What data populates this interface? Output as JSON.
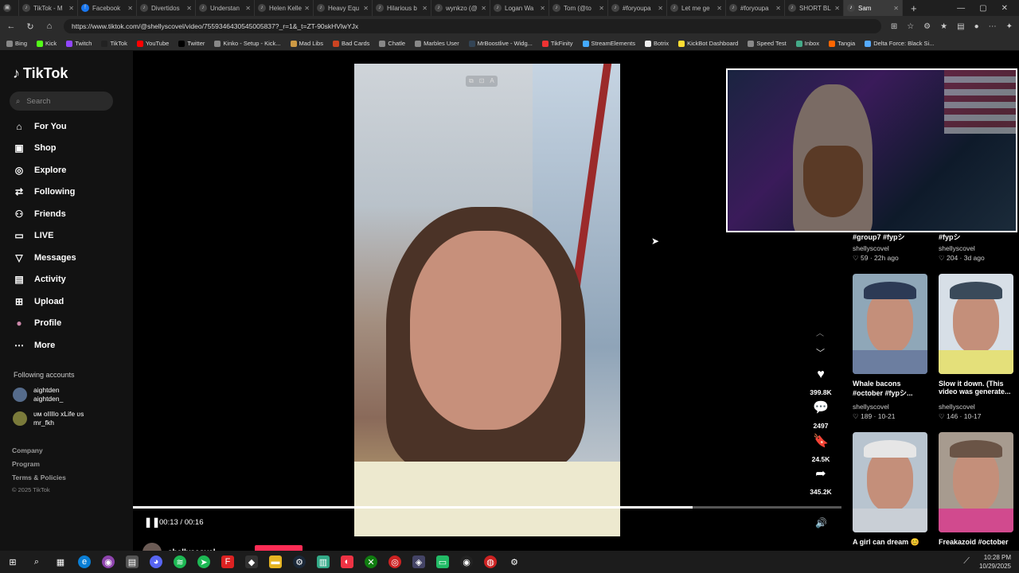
{
  "browser": {
    "tabs": [
      {
        "label": "TikTok - M",
        "icon": "tiktok-icon",
        "active": false
      },
      {
        "label": "Facebook",
        "icon": "facebook-icon",
        "active": false
      },
      {
        "label": "Divertidos",
        "icon": "tiktok-icon",
        "active": false
      },
      {
        "label": "Understan",
        "icon": "tiktok-icon",
        "active": false
      },
      {
        "label": "Helen Kelle",
        "icon": "tiktok-icon",
        "active": false
      },
      {
        "label": "Heavy Equ",
        "icon": "tiktok-icon",
        "active": false
      },
      {
        "label": "Hilarious b",
        "icon": "tiktok-icon",
        "active": false
      },
      {
        "label": "wynkzo (@",
        "icon": "tiktok-icon",
        "active": false
      },
      {
        "label": "Logan Wa",
        "icon": "tiktok-icon",
        "active": false
      },
      {
        "label": "Tom (@to",
        "icon": "tiktok-icon",
        "active": false
      },
      {
        "label": "#foryoupa",
        "icon": "tiktok-icon",
        "active": false
      },
      {
        "label": "Let me ge",
        "icon": "tiktok-icon",
        "active": false
      },
      {
        "label": "#foryoupa",
        "icon": "tiktok-icon",
        "active": false
      },
      {
        "label": "SHORT BL",
        "icon": "tiktok-icon",
        "active": false
      },
      {
        "label": "Sam",
        "icon": "tiktok-icon",
        "active": true
      }
    ],
    "new_tab": "+",
    "window_controls": {
      "minimize": "—",
      "maximize": "▢",
      "close": "✕"
    },
    "url": "https://www.tiktok.com/@shellyscovel/video/7559346430545005837?_r=1&_t=ZT-90skHVlwYJx",
    "bookmarks": [
      "Bing",
      "Kick",
      "Twitch",
      "TikTok",
      "YouTube",
      "Twitter",
      "Kinko - Setup - Kick...",
      "Mad Libs",
      "Bad Cards",
      "Chatle",
      "Marbles User",
      "MrBoostlive - Widg...",
      "TikFinity",
      "StreamElements",
      "Botrix",
      "KickBot Dashboard",
      "Speed Test",
      "Inbox",
      "Tangia",
      "Delta Force: Black Si..."
    ]
  },
  "sidebar": {
    "logo": "TikTok",
    "search_placeholder": "Search",
    "menu": [
      {
        "label": "For You",
        "icon": "home-icon"
      },
      {
        "label": "Shop",
        "icon": "shop-icon"
      },
      {
        "label": "Explore",
        "icon": "compass-icon"
      },
      {
        "label": "Following",
        "icon": "following-icon"
      },
      {
        "label": "Friends",
        "icon": "friends-icon"
      },
      {
        "label": "LIVE",
        "icon": "live-icon"
      },
      {
        "label": "Messages",
        "icon": "messages-icon"
      },
      {
        "label": "Activity",
        "icon": "activity-icon"
      },
      {
        "label": "Upload",
        "icon": "upload-icon"
      },
      {
        "label": "Profile",
        "icon": "profile-icon"
      },
      {
        "label": "More",
        "icon": "more-icon"
      }
    ],
    "following_title": "Following accounts",
    "following": [
      {
        "name": "aightden",
        "handle": "aightden_"
      },
      {
        "name": "ᴜᴍ oIIIIo xLife ᴜs",
        "handle": "mr_fkh"
      }
    ],
    "footer": [
      "Company",
      "Program",
      "Terms & Policies"
    ],
    "copyright": "© 2025 TikTok"
  },
  "player": {
    "elapsed": "00:13",
    "duration": "00:16",
    "progress_fraction": 0.79,
    "likes": "399.8K",
    "comments": "2497",
    "saves": "24.5K",
    "shares": "345.2K",
    "author": "shellyscovel"
  },
  "related": [
    {
      "caption": "#group7 #fypシ",
      "author": "shellyscovel",
      "likes": "59",
      "age": "22h ago"
    },
    {
      "caption": "#fypシ",
      "author": "shellyscovel",
      "likes": "204",
      "age": "3d ago"
    },
    {
      "caption": "Whale bacons #october #fypシ...",
      "author": "shellyscovel",
      "likes": "189",
      "age": "10-21"
    },
    {
      "caption": "Slow it down. (This video was generate...",
      "author": "shellyscovel",
      "likes": "146",
      "age": "10-17"
    },
    {
      "caption": "A girl can dream 😊",
      "author": "",
      "likes": "",
      "age": ""
    },
    {
      "caption": "Freakazoid #october",
      "author": "",
      "likes": "",
      "age": ""
    }
  ],
  "taskbar": {
    "time": "10:28 PM",
    "date": "10/29/2025"
  },
  "colors": {
    "accent": "#fe2c55",
    "background": "#000000",
    "sidebar": "#121212"
  }
}
